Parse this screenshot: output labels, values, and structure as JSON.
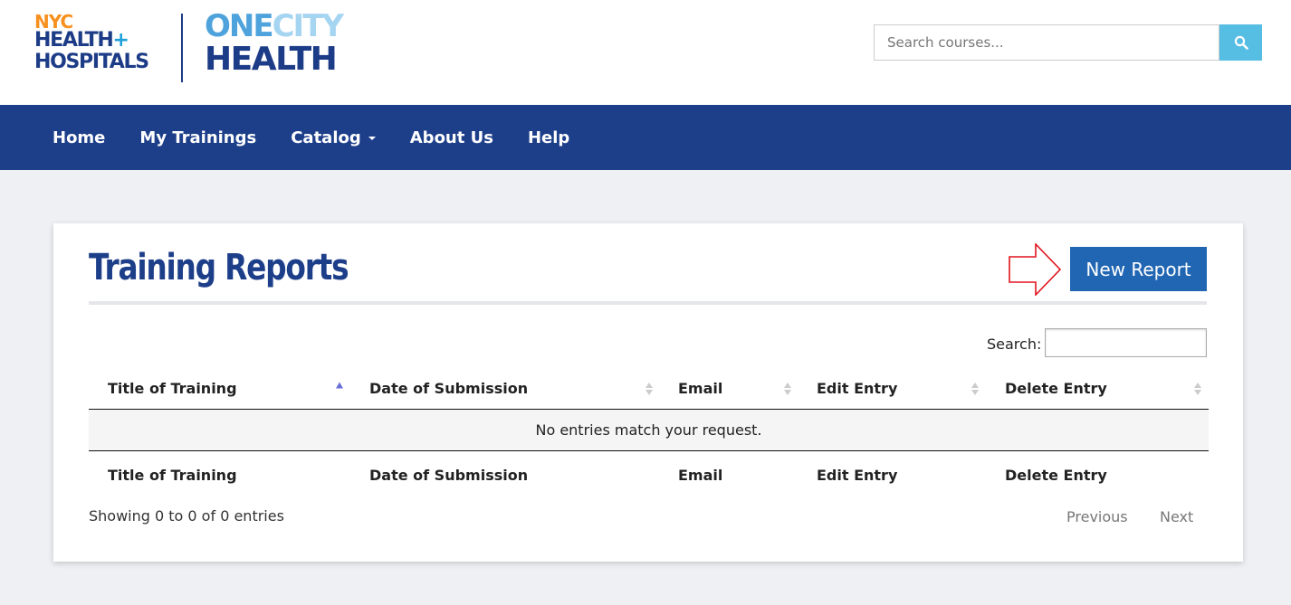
{
  "header": {
    "logo_nyc": {
      "line1": "NYC",
      "line2": "HEALTH",
      "line2_plus": "+",
      "line3": "HOSPITALS"
    },
    "logo_onecity": {
      "one": "ONE",
      "city": "CITY",
      "health": "HEALTH"
    },
    "search": {
      "placeholder": "Search courses...",
      "icon": "search-icon"
    }
  },
  "nav": {
    "items": [
      {
        "label": "Home"
      },
      {
        "label": "My Trainings"
      },
      {
        "label": "Catalog",
        "dropdown": true
      },
      {
        "label": "About Us"
      },
      {
        "label": "Help"
      }
    ]
  },
  "main": {
    "title": "Training Reports",
    "new_report_label": "New Report",
    "search_label": "Search:",
    "table": {
      "columns": [
        "Title of Training",
        "Date of Submission",
        "Email",
        "Edit Entry",
        "Delete Entry"
      ],
      "sorted_column": 0,
      "empty_message": "No entries match your request."
    },
    "info": "Showing 0 to 0 of 0 entries",
    "pagination": {
      "previous": "Previous",
      "next": "Next"
    }
  },
  "colors": {
    "nav_bg": "#1d3f8a",
    "accent": "#2166b3",
    "search_button": "#56bde3",
    "pointer_arrow": "#e0141e"
  }
}
